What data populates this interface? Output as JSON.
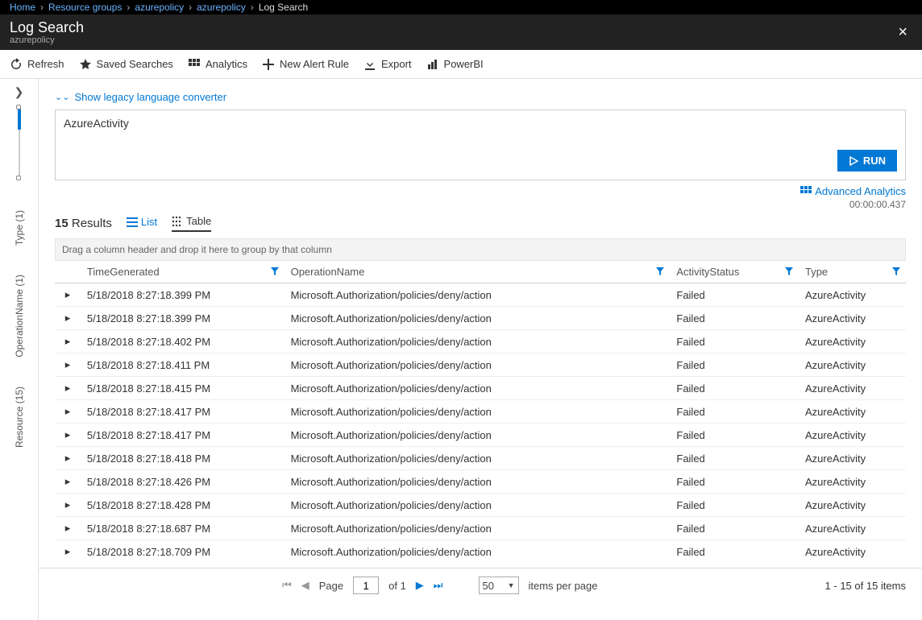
{
  "breadcrumb": {
    "items": [
      "Home",
      "Resource groups",
      "azurepolicy",
      "azurepolicy"
    ],
    "current": "Log Search"
  },
  "header": {
    "title": "Log Search",
    "subtitle": "azurepolicy",
    "close": "×"
  },
  "toolbar": {
    "refresh": "Refresh",
    "saved_searches": "Saved Searches",
    "analytics": "Analytics",
    "new_alert_rule": "New Alert Rule",
    "export": "Export",
    "powerbi": "PowerBI"
  },
  "left_rail": {
    "type": "Type (1)",
    "operation_name": "OperationName (1)",
    "resource": "Resource (15)"
  },
  "legacy_link": "Show legacy language converter",
  "query": {
    "text": "AzureActivity",
    "run_label": "RUN"
  },
  "advanced_link": "Advanced Analytics",
  "elapsed": "00:00:00.437",
  "results": {
    "count": "15",
    "count_label": "Results",
    "list_label": "List",
    "table_label": "Table",
    "group_hint": "Drag a column header and drop it here to group by that column",
    "columns": {
      "time": "TimeGenerated",
      "op": "OperationName",
      "status": "ActivityStatus",
      "type": "Type"
    },
    "rows": [
      {
        "time": "5/18/2018 8:27:18.399 PM",
        "op": "Microsoft.Authorization/policies/deny/action",
        "status": "Failed",
        "type": "AzureActivity"
      },
      {
        "time": "5/18/2018 8:27:18.399 PM",
        "op": "Microsoft.Authorization/policies/deny/action",
        "status": "Failed",
        "type": "AzureActivity"
      },
      {
        "time": "5/18/2018 8:27:18.402 PM",
        "op": "Microsoft.Authorization/policies/deny/action",
        "status": "Failed",
        "type": "AzureActivity"
      },
      {
        "time": "5/18/2018 8:27:18.411 PM",
        "op": "Microsoft.Authorization/policies/deny/action",
        "status": "Failed",
        "type": "AzureActivity"
      },
      {
        "time": "5/18/2018 8:27:18.415 PM",
        "op": "Microsoft.Authorization/policies/deny/action",
        "status": "Failed",
        "type": "AzureActivity"
      },
      {
        "time": "5/18/2018 8:27:18.417 PM",
        "op": "Microsoft.Authorization/policies/deny/action",
        "status": "Failed",
        "type": "AzureActivity"
      },
      {
        "time": "5/18/2018 8:27:18.417 PM",
        "op": "Microsoft.Authorization/policies/deny/action",
        "status": "Failed",
        "type": "AzureActivity"
      },
      {
        "time": "5/18/2018 8:27:18.418 PM",
        "op": "Microsoft.Authorization/policies/deny/action",
        "status": "Failed",
        "type": "AzureActivity"
      },
      {
        "time": "5/18/2018 8:27:18.426 PM",
        "op": "Microsoft.Authorization/policies/deny/action",
        "status": "Failed",
        "type": "AzureActivity"
      },
      {
        "time": "5/18/2018 8:27:18.428 PM",
        "op": "Microsoft.Authorization/policies/deny/action",
        "status": "Failed",
        "type": "AzureActivity"
      },
      {
        "time": "5/18/2018 8:27:18.687 PM",
        "op": "Microsoft.Authorization/policies/deny/action",
        "status": "Failed",
        "type": "AzureActivity"
      },
      {
        "time": "5/18/2018 8:27:18.709 PM",
        "op": "Microsoft.Authorization/policies/deny/action",
        "status": "Failed",
        "type": "AzureActivity"
      }
    ]
  },
  "pager": {
    "page_label": "Page",
    "page": "1",
    "of_label": "of 1",
    "page_size": "50",
    "per_page_label": "items per page",
    "summary": "1 - 15 of 15 items"
  }
}
